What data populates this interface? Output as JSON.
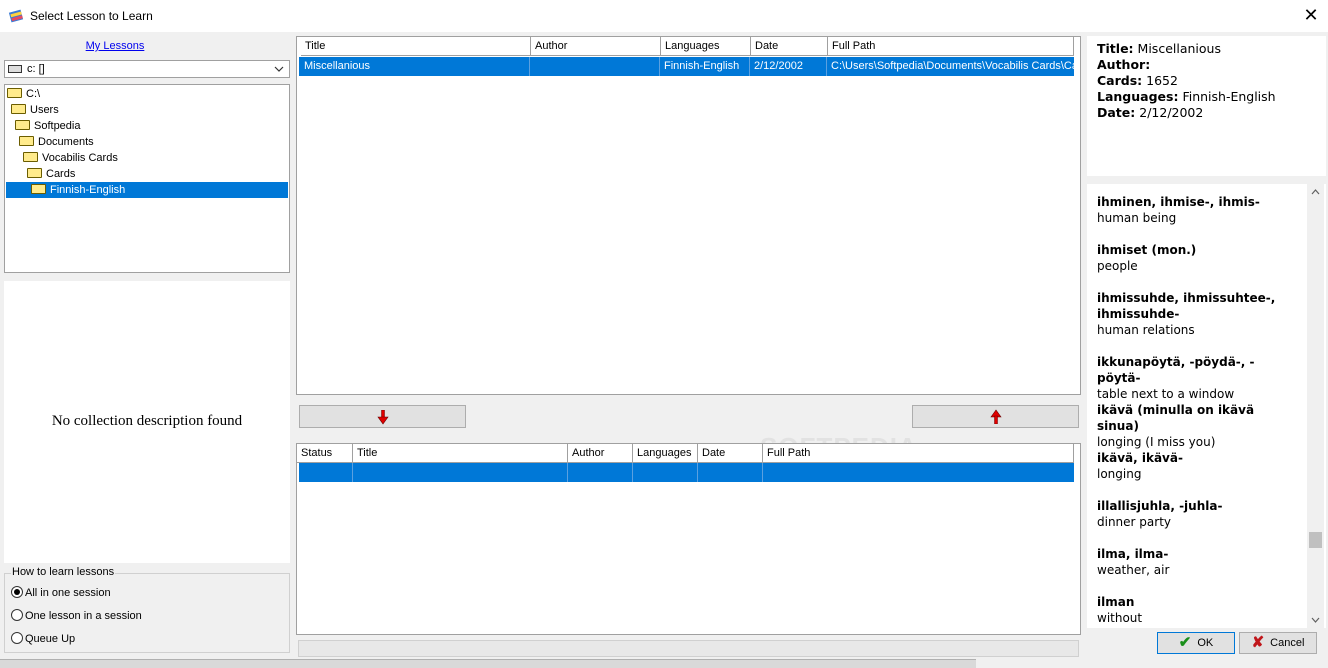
{
  "window": {
    "title": "Select Lesson to Learn",
    "close_glyph": "✕"
  },
  "left": {
    "my_lessons_link": "My Lessons",
    "drive": "c: []",
    "tree": [
      "C:\\",
      "Users",
      "Softpedia",
      "Documents",
      "Vocabilis Cards",
      "Cards",
      "Finnish-English"
    ],
    "description": "No collection description found",
    "learn_group": {
      "title": "How to learn lessons",
      "options": [
        "All in one session",
        "One lesson in a session",
        "Queue Up"
      ],
      "selected": "All in one session"
    }
  },
  "top_grid": {
    "columns": [
      "Title",
      "Author",
      "Languages",
      "Date",
      "Full Path"
    ],
    "rows": [
      {
        "title": "Miscellanious",
        "author": "",
        "languages": "Finnish-English",
        "date": "2/12/2002",
        "path": "C:\\Users\\Softpedia\\Documents\\Vocabilis Cards\\Ca"
      }
    ]
  },
  "move_buttons": {
    "down_icon": "red-down-arrow",
    "up_icon": "red-up-arrow"
  },
  "bottom_grid": {
    "columns": [
      "Status",
      "Title",
      "Author",
      "Languages",
      "Date",
      "Full Path"
    ]
  },
  "info": {
    "title_label": "Title:",
    "title_value": "Miscellanious",
    "author_label": "Author:",
    "author_value": "",
    "cards_label": "Cards:",
    "cards_value": "1652",
    "languages_label": "Languages:",
    "languages_value": "Finnish-English",
    "date_label": "Date:",
    "date_value": "2/12/2002"
  },
  "vocab": [
    {
      "term": "ihminen, ihmise-, ihmis-",
      "meaning": "human being"
    },
    {
      "term": "ihmiset (mon.)",
      "meaning": "people"
    },
    {
      "term": "ihmissuhde, ihmissuhtee-, ihmissuhde-",
      "meaning": "human relations"
    },
    {
      "term": "ikkunapöytä, -pöydä-, -pöytä-",
      "meaning": "table next to a window"
    },
    {
      "term": "ikävä (minulla on ikävä sinua)",
      "meaning": "longing (I miss you)"
    },
    {
      "term": "ikävä, ikävä-",
      "meaning": "longing"
    },
    {
      "term": "illallisjuhla, -juhla-",
      "meaning": "dinner party"
    },
    {
      "term": "ilma, ilma-",
      "meaning": "weather, air"
    },
    {
      "term": "ilman",
      "meaning": "without"
    }
  ],
  "buttons": {
    "ok": "OK",
    "cancel": "Cancel"
  },
  "watermark": "SOFTPEDIA",
  "colors": {
    "selection": "#0078d7",
    "link": "#0000ee",
    "arrow": "#e00000"
  }
}
